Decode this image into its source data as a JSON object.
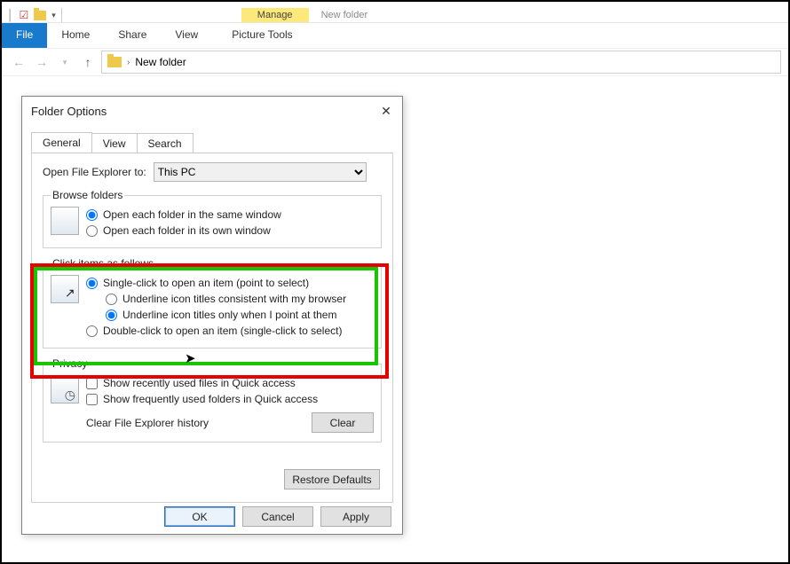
{
  "ribbon": {
    "context_manage": "Manage",
    "context_newfolder": "New folder",
    "tabs": {
      "file": "File",
      "home": "Home",
      "share": "Share",
      "view": "View",
      "ptools": "Picture Tools"
    }
  },
  "address": {
    "folder_name": "New folder"
  },
  "dialog": {
    "title": "Folder Options",
    "tabs": {
      "general": "General",
      "view": "View",
      "search": "Search"
    },
    "open_to_label": "Open File Explorer to:",
    "open_to_value": "This PC",
    "browse_legend": "Browse folders",
    "browse_same": "Open each folder in the same window",
    "browse_own": "Open each folder in its own window",
    "click_legend": "Click items as follows",
    "single_click": "Single-click to open an item (point to select)",
    "underline_browser": "Underline icon titles consistent with my browser",
    "underline_point": "Underline icon titles only when I point at them",
    "double_click": "Double-click to open an item (single-click to select)",
    "privacy_legend": "Privacy",
    "show_recent_files": "Show recently used files in Quick access",
    "show_freq_folders": "Show frequently used folders in Quick access",
    "clear_history_label": "Clear File Explorer history",
    "clear_btn": "Clear",
    "restore_btn": "Restore Defaults",
    "ok": "OK",
    "cancel": "Cancel",
    "apply": "Apply"
  }
}
